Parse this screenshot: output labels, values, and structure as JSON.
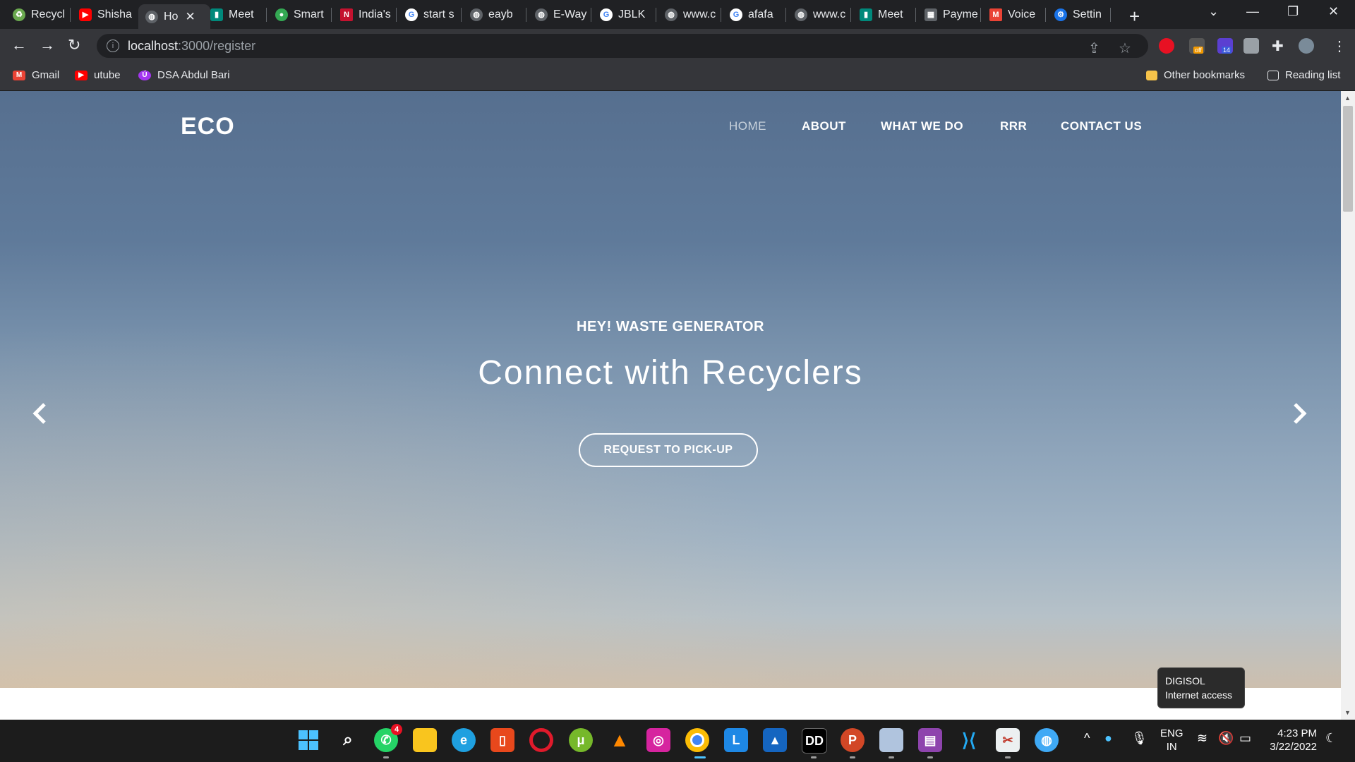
{
  "tabs": [
    {
      "label": "Recycl",
      "icon": "recycle-icon",
      "color": "#6aa84f"
    },
    {
      "label": "Shisha",
      "icon": "youtube-icon",
      "color": "#ff0000"
    },
    {
      "label": "Ho",
      "icon": "globe-icon",
      "color": "#9aa0a6",
      "active": true
    },
    {
      "label": "Meet",
      "icon": "meet-icon",
      "color": "#00897b"
    },
    {
      "label": "Smart",
      "icon": "map-pin-icon",
      "color": "#34a853"
    },
    {
      "label": "India's",
      "icon": "n-icon",
      "color": "#c4122f"
    },
    {
      "label": "start s",
      "icon": "google-icon",
      "color": "#ffffff"
    },
    {
      "label": "eayb",
      "icon": "globe-icon",
      "color": "#9aa0a6"
    },
    {
      "label": "E-Way",
      "icon": "globe-icon",
      "color": "#9aa0a6"
    },
    {
      "label": "JBLK",
      "icon": "google-icon",
      "color": "#ffffff"
    },
    {
      "label": "www.c",
      "icon": "globe-icon",
      "color": "#9aa0a6"
    },
    {
      "label": "afafa",
      "icon": "google-icon",
      "color": "#ffffff"
    },
    {
      "label": "www.c",
      "icon": "globe-icon",
      "color": "#9aa0a6"
    },
    {
      "label": "Meet",
      "icon": "meet-icon",
      "color": "#00897b"
    },
    {
      "label": "Payme",
      "icon": "payment-icon",
      "color": "#9aa0a6"
    },
    {
      "label": "Voice",
      "icon": "gmail-icon",
      "color": "#ea4335"
    },
    {
      "label": "Settin",
      "icon": "gear-icon",
      "color": "#1a73e8"
    }
  ],
  "address": {
    "host": "localhost",
    "path": ":3000/register"
  },
  "bookmarks": [
    {
      "label": "Gmail",
      "icon": "gmail-icon",
      "color": "#ea4335"
    },
    {
      "label": "utube",
      "icon": "youtube-icon",
      "color": "#ff0000"
    },
    {
      "label": "DSA Abdul Bari",
      "icon": "udemy-icon",
      "color": "#a435f0"
    }
  ],
  "bookmarks_right": {
    "other": "Other bookmarks",
    "reading": "Reading list"
  },
  "extensions": {
    "badge_off": "off",
    "badge_count": "14"
  },
  "site": {
    "brand": "ECO",
    "nav": [
      "HOME",
      "ABOUT",
      "WHAT WE DO",
      "RRR",
      "CONTACT US"
    ],
    "kicker": "HEY! WASTE GENERATOR",
    "headline": "Connect with Recyclers",
    "cta": "REQUEST TO PICK-UP"
  },
  "tooltip": {
    "line1": "DIGISOL",
    "line2": "Internet access"
  },
  "taskbar": {
    "apps": [
      "windows-start-icon",
      "search-icon",
      "whatsapp-icon",
      "file-explorer-icon",
      "edge-icon",
      "office-icon",
      "opera-icon",
      "utorrent-icon",
      "vlc-icon",
      "instagram-icon",
      "chrome-icon",
      "l-app-icon",
      "photos-icon",
      "dolby-icon",
      "powerpoint-icon",
      "monitor-icon",
      "winrar-icon",
      "vscode-icon",
      "snipping-icon",
      "web-icon"
    ],
    "whatsapp_badge": "4",
    "lang1": "ENG",
    "lang2": "IN",
    "time": "4:23 PM",
    "date": "3/22/2022"
  }
}
